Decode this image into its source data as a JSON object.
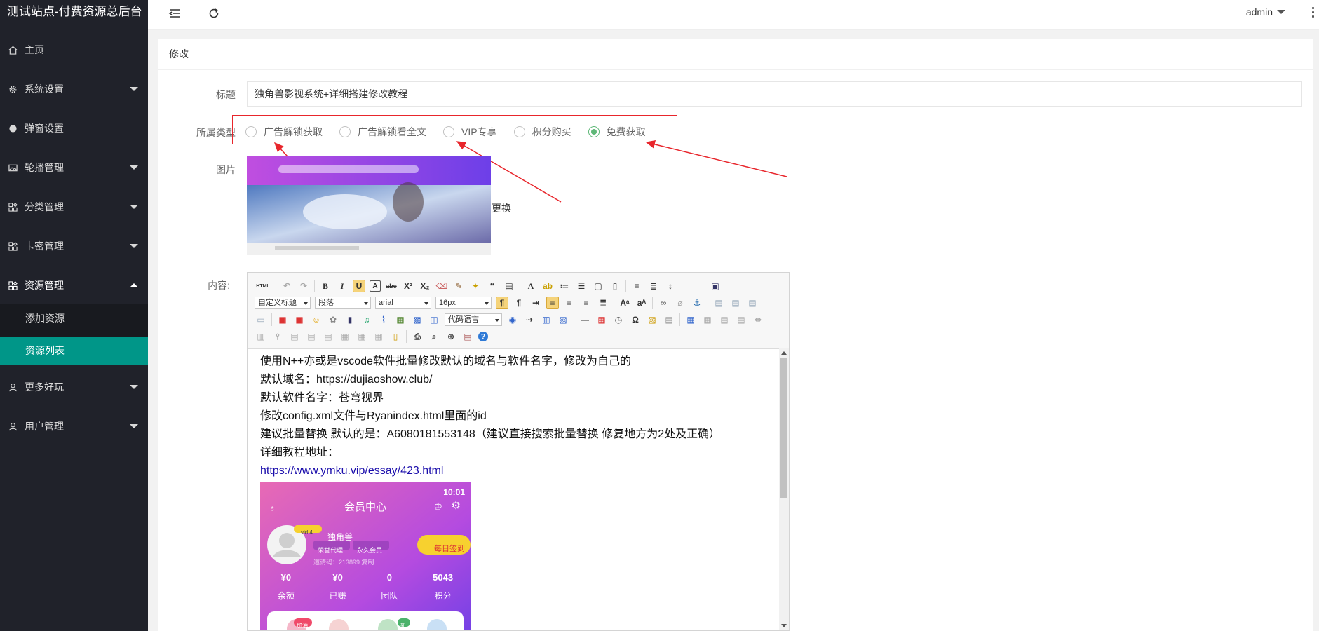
{
  "app": {
    "title": "测试站点-付费资源总后台"
  },
  "sidebar": {
    "items": [
      {
        "label": "主页",
        "icon": "home-icon"
      },
      {
        "label": "系统设置",
        "icon": "gear-icon"
      },
      {
        "label": "弹窗设置",
        "icon": "circle-icon"
      },
      {
        "label": "轮播管理",
        "icon": "image-icon"
      },
      {
        "label": "分类管理",
        "icon": "grid-icon"
      },
      {
        "label": "卡密管理",
        "icon": "grid-icon"
      },
      {
        "label": "资源管理",
        "icon": "grid-icon"
      },
      {
        "label": "更多好玩",
        "icon": "user-icon"
      },
      {
        "label": "用户管理",
        "icon": "user-icon"
      }
    ],
    "subitems": [
      {
        "label": "添加资源"
      },
      {
        "label": "资源列表"
      }
    ]
  },
  "header": {
    "user": "admin"
  },
  "card": {
    "title": "修改"
  },
  "form": {
    "title_label": "标题",
    "title_value": "独角兽影视系统+详细搭建修改教程",
    "type_label": "所属类型",
    "types": [
      "广告解锁获取",
      "广告解锁看全文",
      "VIP专享",
      "积分购买",
      "免费获取"
    ],
    "selected_type": "免费获取",
    "image_label": "图片",
    "change_label": "更换",
    "content_label": "内容:"
  },
  "editor": {
    "toolbar": {
      "custom_heading": "自定义标题",
      "paragraph": "段落",
      "font": "arial",
      "size": "16px",
      "code_lang": "代码语言"
    },
    "lines": [
      "使用N++亦或是vscode软件批量修改默认的域名与软件名字，修改为自己的",
      "默认域名：https://dujiaoshow.club/",
      "默认软件名字：苍穹视界",
      "修改config.xml文件与Ryanindex.html里面的id",
      "建议批量替换  默认的是：A6080181553148（建议直接搜索批量替换 修复地方为2处及正确）",
      "详细教程地址："
    ],
    "link": "https://www.ymku.vip/essay/423.html",
    "phone": {
      "time": "10:01",
      "title": "会员中心",
      "username": "独角兽",
      "level": "vid 4",
      "badge1": "荣誉代理",
      "badge2": "永久会员",
      "invite": "邀请码：213899 复制",
      "signin": "每日签到",
      "stats": [
        {
          "value": "¥0",
          "label": "余额"
        },
        {
          "value": "¥0",
          "label": "已赚"
        },
        {
          "value": "0",
          "label": "团队"
        },
        {
          "value": "5043",
          "label": "积分"
        }
      ],
      "tag1": "加油",
      "tag2": "新"
    }
  },
  "colors": {
    "sidebar": "#20222a",
    "accent": "#009688",
    "radio": "#5fb878",
    "annotation": "#e8262c"
  }
}
